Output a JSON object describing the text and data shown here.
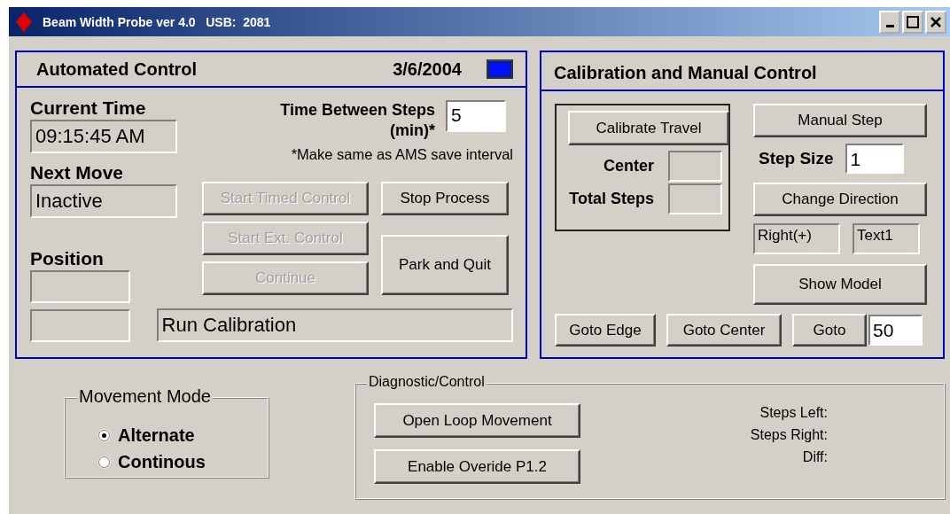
{
  "window": {
    "title": "Beam Width Probe ver 4.0   USB:  2081"
  },
  "automated_control": {
    "title": "Automated Control",
    "date": "3/6/2004",
    "current_time": {
      "label": "Current Time",
      "value": "09:15:45 AM"
    },
    "next_move": {
      "label": "Next Move",
      "value": "Inactive"
    },
    "position": {
      "label": "Position"
    },
    "time_between_steps": {
      "label": "Time Between Steps",
      "unit": "(min)*",
      "value": "5",
      "note": "*Make same as AMS save interval"
    },
    "buttons": [
      {
        "label": "Start Timed Control",
        "disabled": true
      },
      {
        "label": "Stop Process",
        "disabled": false
      },
      {
        "label": "Start Ext. Control",
        "disabled": true
      },
      {
        "label": "Park and Quit",
        "disabled": false
      },
      {
        "label": "Continue",
        "disabled": true
      }
    ],
    "status": "Run Calibration"
  },
  "calibration": {
    "title": "Calibration and Manual Control",
    "calibrate_button": "Calibrate Travel",
    "center_label": "Center",
    "total_steps_label": "Total Steps",
    "manual_step_button": "Manual Step",
    "step_size": {
      "label": "Step Size",
      "value": "1"
    },
    "change_direction_button": "Change Direction",
    "direction": "Right(+)",
    "text_field": "Text1",
    "show_model_button": "Show Model",
    "goto_buttons": [
      "Goto Edge",
      "Goto Center",
      "Goto"
    ],
    "goto_value": "50"
  },
  "movement_mode": {
    "title": "Movement Mode",
    "options": [
      {
        "label": "Alternate",
        "selected": true
      },
      {
        "label": "Continous",
        "selected": false
      }
    ]
  },
  "diagnostic": {
    "title": "Diagnostic/Control",
    "buttons": [
      "Open Loop Movement",
      "Enable Overide P1.2"
    ],
    "readouts": [
      "Steps Left:",
      "Steps Right:",
      "Diff:"
    ]
  }
}
